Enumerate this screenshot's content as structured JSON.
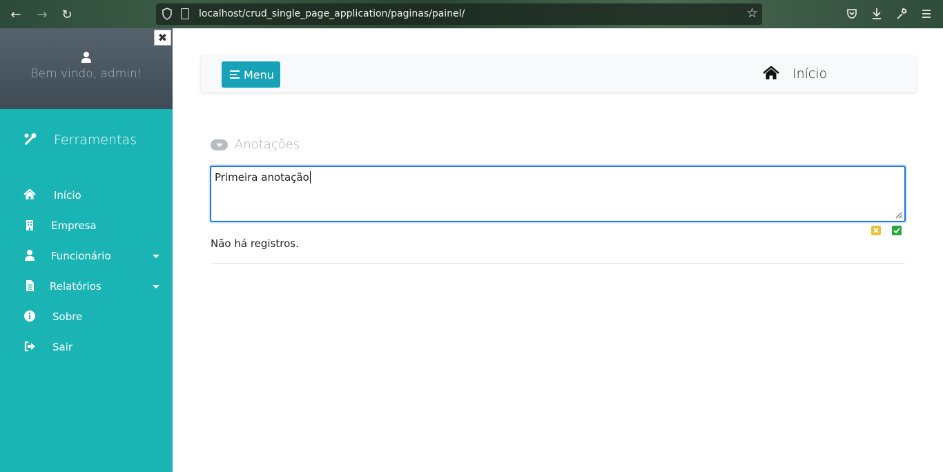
{
  "browser": {
    "url": "localhost/crud_single_page_application/paginas/painel/"
  },
  "sidebar": {
    "welcome": "Bem vindo, admin!",
    "close_glyph": "✖",
    "section_title": "Ferramentas",
    "items": [
      {
        "label": "Início",
        "icon": "home-icon"
      },
      {
        "label": "Empresa",
        "icon": "building-icon"
      },
      {
        "label": "Funcionário",
        "icon": "user-icon",
        "has_dropdown": true
      },
      {
        "label": "Relatórios",
        "icon": "file-icon",
        "has_dropdown": true
      },
      {
        "label": "Sobre",
        "icon": "info-icon"
      },
      {
        "label": "Sair",
        "icon": "sign-out-icon"
      }
    ]
  },
  "topnav": {
    "menu_label": "Menu",
    "page_label": "Início"
  },
  "notes": {
    "title": "Anotações",
    "input_value": "Primeira anotação",
    "empty_text": "Não há registros."
  },
  "colors": {
    "sidebar": "#1bb4b5",
    "sidebar_header": "#4a5660",
    "menu_button": "#17a2b8",
    "focus_border": "#1a73e8",
    "cancel_icon": "#e8c33c",
    "confirm_icon": "#28a745"
  }
}
